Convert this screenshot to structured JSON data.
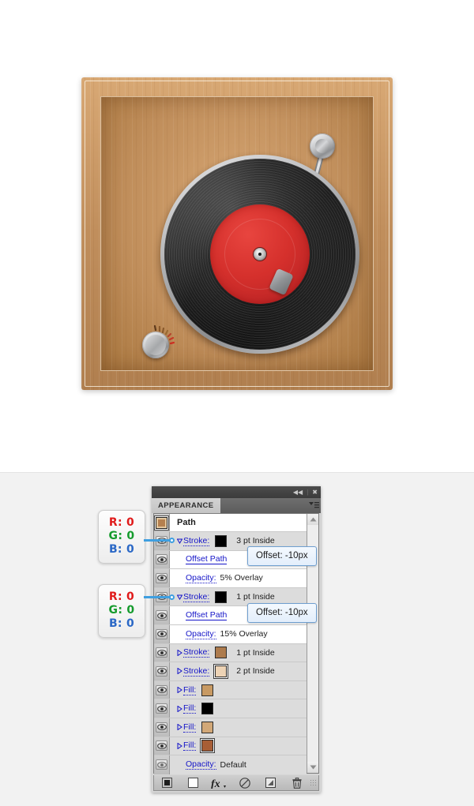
{
  "illustration": {
    "name": "vinyl-record-turntable",
    "description": "Wooden-cased turntable with black vinyl record, red center label and metal tonearm",
    "colors": {
      "wood_frame": "#C08E5C",
      "wood_plate": "#D6A673",
      "record_black": "#181818",
      "label_red": "#D5302C",
      "metal": "#C9CACC"
    }
  },
  "panel": {
    "titlebar": {
      "collapse_icon": "double-chevron-left-icon",
      "collapse_glyph": "◀◀",
      "separator": "|",
      "close_icon": "close-icon",
      "close_glyph": "✖"
    },
    "tab": {
      "label": "APPEARANCE",
      "menu_icon": "panel-menu-icon"
    },
    "header_row": {
      "thumbnail": "path-thumbnail",
      "title": "Path"
    },
    "rows": [
      {
        "type": "stroke",
        "visibility_icon": "eye-icon",
        "disclosure": "triangle-down-icon",
        "label": "Stroke:",
        "swatch_color": "#000000",
        "swatch_selected": false,
        "meta": "3 pt  Inside",
        "shaded": true
      },
      {
        "type": "effect",
        "visibility_icon": "eye-icon",
        "label": "Offset Path",
        "meta": "",
        "shaded": false
      },
      {
        "type": "opacity",
        "visibility_icon": "eye-icon",
        "label": "Opacity:",
        "value": "5% Overlay",
        "shaded": false
      },
      {
        "type": "stroke",
        "visibility_icon": "eye-icon",
        "disclosure": "triangle-down-icon",
        "label": "Stroke:",
        "swatch_color": "#000000",
        "swatch_selected": false,
        "meta": "1 pt  Inside",
        "shaded": true
      },
      {
        "type": "effect",
        "visibility_icon": "eye-icon",
        "label": "Offset Path",
        "meta": "",
        "shaded": false
      },
      {
        "type": "opacity",
        "visibility_icon": "eye-icon",
        "label": "Opacity:",
        "value": "15% Overlay",
        "shaded": false
      },
      {
        "type": "stroke",
        "visibility_icon": "eye-icon",
        "disclosure": "triangle-right-icon",
        "label": "Stroke:",
        "swatch_color": "#AD7B4D",
        "swatch_selected": false,
        "meta": "1 pt  Inside",
        "shaded": true
      },
      {
        "type": "stroke",
        "visibility_icon": "eye-icon",
        "disclosure": "triangle-right-icon",
        "label": "Stroke:",
        "swatch_color": "#EDD3B5",
        "swatch_selected": true,
        "meta": "2 pt  Inside",
        "shaded": true
      },
      {
        "type": "fill",
        "visibility_icon": "eye-icon",
        "disclosure": "triangle-right-icon",
        "label": "Fill:",
        "swatch_color": "#C89A63",
        "swatch_selected": false,
        "meta": "",
        "shaded": true
      },
      {
        "type": "fill",
        "visibility_icon": "eye-icon",
        "disclosure": "triangle-right-icon",
        "label": "Fill:",
        "swatch_color": "#000000",
        "swatch_selected": false,
        "meta": "",
        "shaded": true
      },
      {
        "type": "fill",
        "visibility_icon": "eye-icon",
        "disclosure": "triangle-right-icon",
        "label": "Fill:",
        "swatch_color": "#D2A878",
        "swatch_selected": false,
        "meta": "",
        "shaded": true
      },
      {
        "type": "fill",
        "visibility_icon": "eye-icon",
        "disclosure": "triangle-right-icon",
        "label": "Fill:",
        "swatch_color": "#A85E36",
        "swatch_selected": true,
        "meta": "",
        "shaded": true
      },
      {
        "type": "opacity",
        "visibility_icon": "eye-icon",
        "label": "Opacity:",
        "value": "Default",
        "shaded": true
      }
    ],
    "scrollbar": {
      "up_icon": "scroll-up-arrow-icon",
      "down_icon": "scroll-down-arrow-icon"
    },
    "footer_buttons": [
      {
        "name": "add-new-stroke-button",
        "icon": "filled-square-icon"
      },
      {
        "name": "add-new-fill-button",
        "icon": "outlined-square-icon"
      },
      {
        "name": "add-new-effect-button",
        "icon": "fx-icon",
        "label": "fx"
      },
      {
        "name": "clear-appearance-button",
        "icon": "no-symbol-icon"
      },
      {
        "name": "duplicate-item-button",
        "icon": "duplicate-icon"
      },
      {
        "name": "delete-item-button",
        "icon": "trash-icon"
      }
    ]
  },
  "tooltips": [
    {
      "name": "offset-tooltip-1",
      "text": "Offset: -10px"
    },
    {
      "name": "offset-tooltip-2",
      "text": "Offset: -10px"
    }
  ],
  "callouts": [
    {
      "name": "rgb-callout-1",
      "r_label": "R: 0",
      "g_label": "G: 0",
      "b_label": "B: 0",
      "leader_color": "#3F9FE0"
    },
    {
      "name": "rgb-callout-2",
      "r_label": "R: 0",
      "g_label": "G: 0",
      "b_label": "B: 0",
      "leader_color": "#3F9FE0"
    }
  ]
}
